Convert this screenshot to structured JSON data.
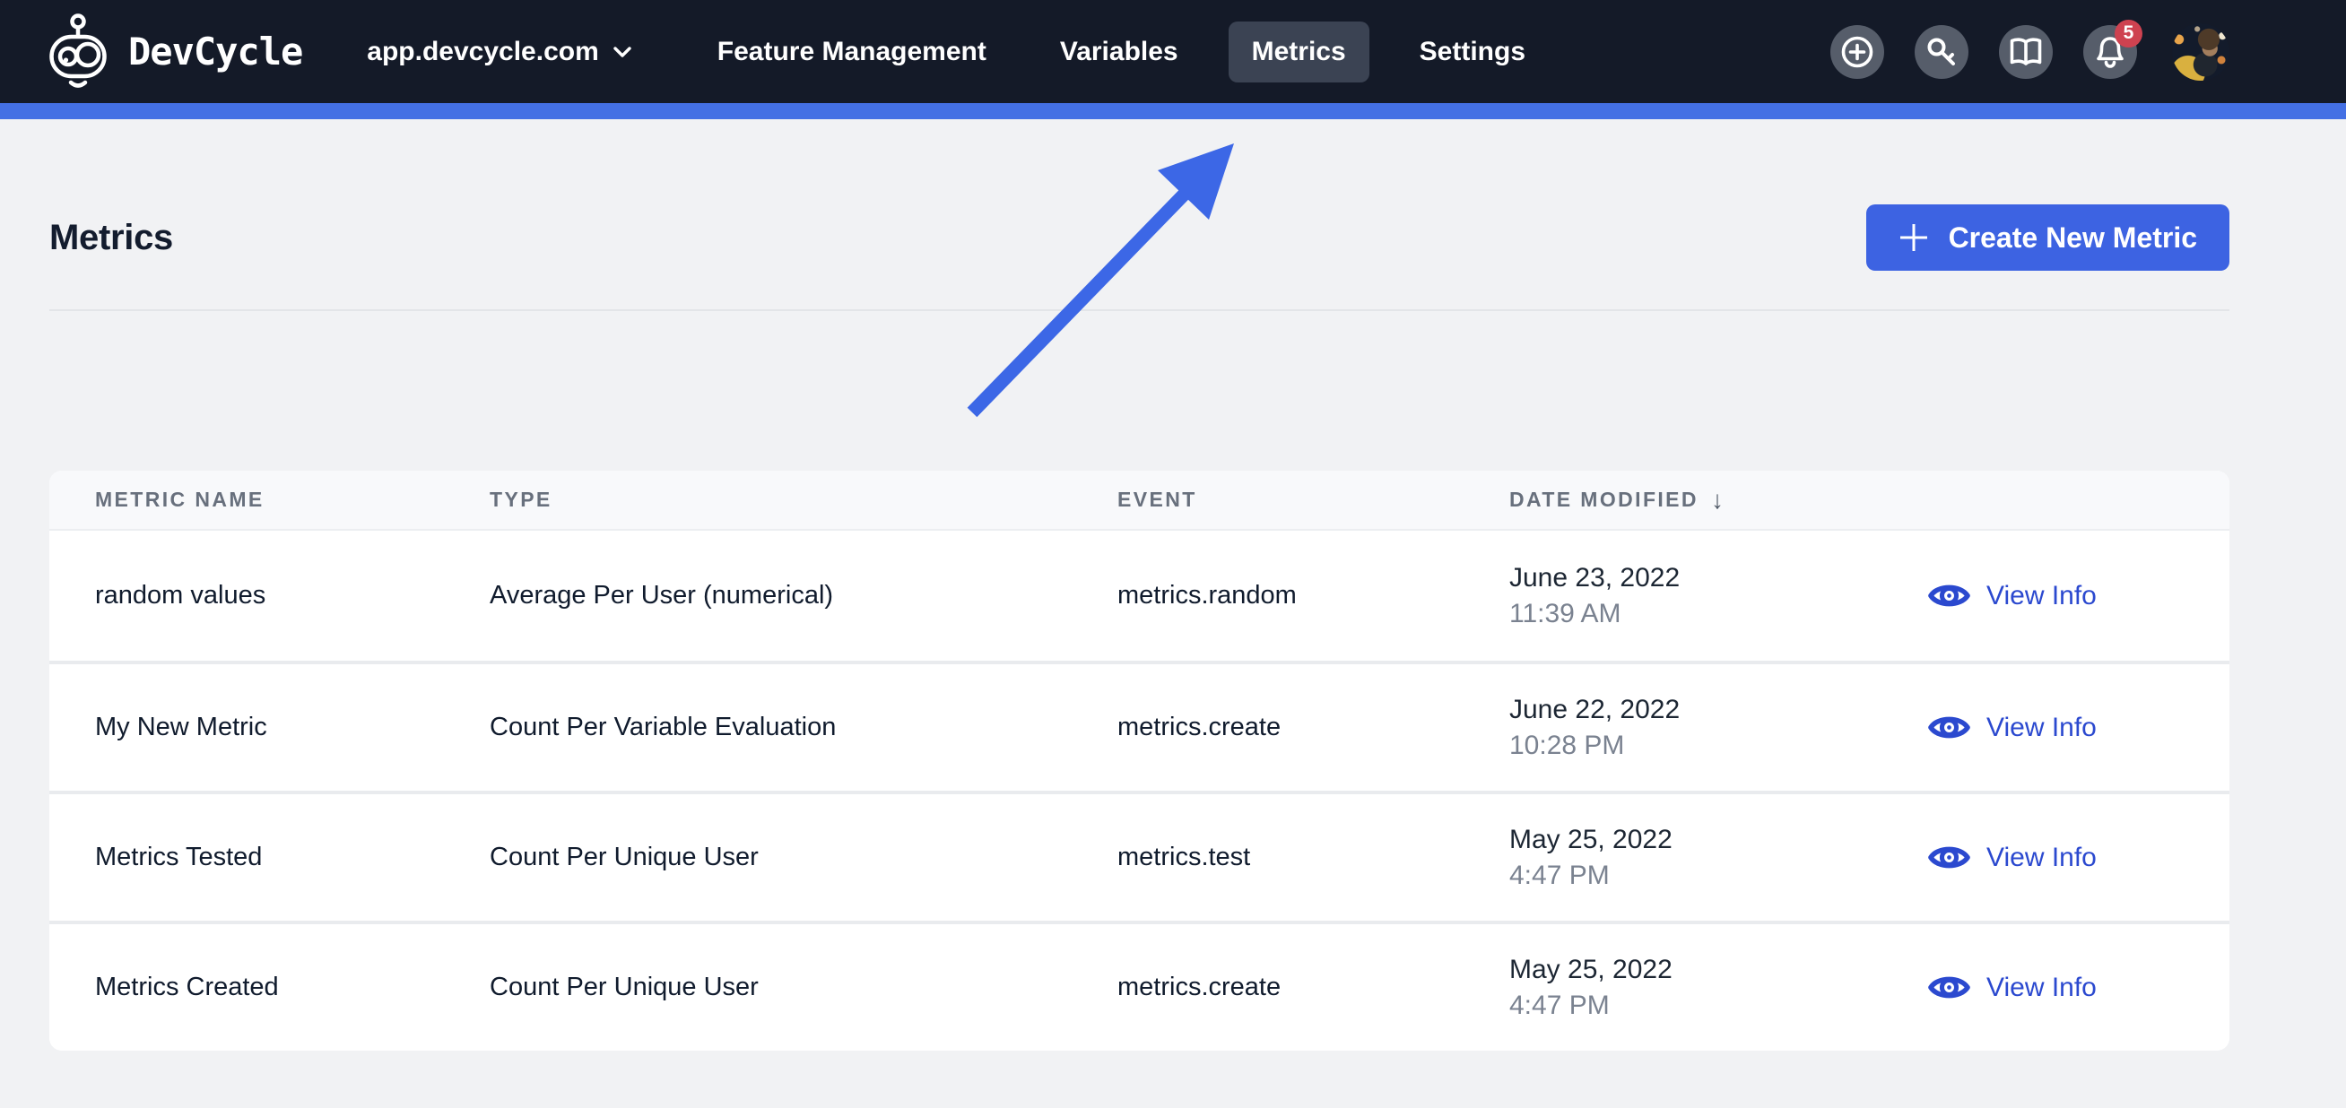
{
  "nav": {
    "brand": "DevCycle",
    "org_selector": "app.devcycle.com",
    "links": [
      {
        "label": "Feature Management",
        "active": false
      },
      {
        "label": "Variables",
        "active": false
      },
      {
        "label": "Metrics",
        "active": true
      },
      {
        "label": "Settings",
        "active": false
      }
    ],
    "actions": [
      {
        "icon": "plus-circle-icon"
      },
      {
        "icon": "key-icon"
      },
      {
        "icon": "book-icon"
      },
      {
        "icon": "bell-icon",
        "badge": "5"
      }
    ],
    "notification_count": "5"
  },
  "page": {
    "title": "Metrics",
    "create_button_label": "Create New Metric"
  },
  "table": {
    "columns": [
      "METRIC NAME",
      "TYPE",
      "EVENT",
      "DATE MODIFIED"
    ],
    "sort_indicator": "↓",
    "rows": [
      {
        "name": "random values",
        "type": "Average Per User (numerical)",
        "event": "metrics.random",
        "date": "June 23, 2022",
        "time": "11:39 AM",
        "action": "View Info"
      },
      {
        "name": "My New Metric",
        "type": "Count Per Variable Evaluation",
        "event": "metrics.create",
        "date": "June 22, 2022",
        "time": "10:28 PM",
        "action": "View Info"
      },
      {
        "name": "Metrics Tested",
        "type": "Count Per Unique User",
        "event": "metrics.test",
        "date": "May 25, 2022",
        "time": "4:47 PM",
        "action": "View Info"
      },
      {
        "name": "Metrics Created",
        "type": "Count Per Unique User",
        "event": "metrics.create",
        "date": "May 25, 2022",
        "time": "4:47 PM",
        "action": "View Info"
      }
    ]
  },
  "colors": {
    "nav_bg": "#141a28",
    "nav_active_pill": "#3b4353",
    "accent_bar": "#4470e4",
    "primary_button": "#3d63e2",
    "link_blue": "#2b49cf",
    "arrow_blue": "#3c67e6",
    "badge_red": "#ce4250",
    "page_bg": "#f1f2f4"
  }
}
